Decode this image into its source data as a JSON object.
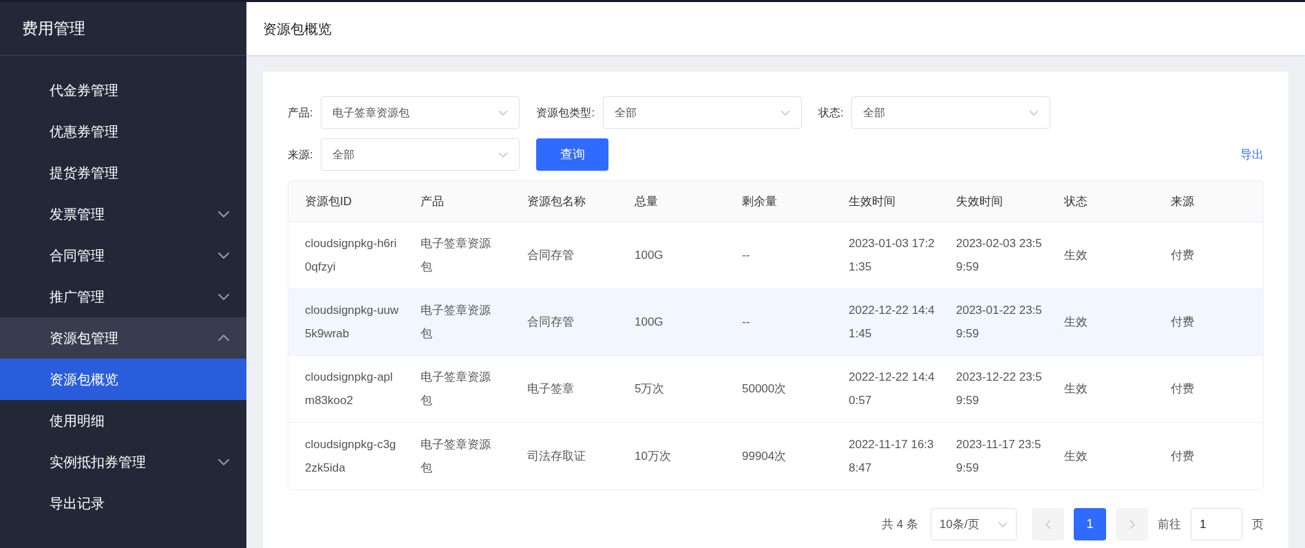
{
  "sidebar": {
    "title": "费用管理",
    "items": [
      {
        "label": "代金券管理",
        "expandable": false,
        "expanded": false,
        "selected": false
      },
      {
        "label": "优惠券管理",
        "expandable": false,
        "expanded": false,
        "selected": false
      },
      {
        "label": "提货券管理",
        "expandable": false,
        "expanded": false,
        "selected": false
      },
      {
        "label": "发票管理",
        "expandable": true,
        "expanded": false,
        "selected": false
      },
      {
        "label": "合同管理",
        "expandable": true,
        "expanded": false,
        "selected": false
      },
      {
        "label": "推广管理",
        "expandable": true,
        "expanded": false,
        "selected": false
      },
      {
        "label": "资源包管理",
        "expandable": true,
        "expanded": true,
        "selected": false,
        "children": [
          {
            "label": "资源包概览",
            "selected": true
          },
          {
            "label": "使用明细",
            "selected": false
          }
        ]
      },
      {
        "label": "实例抵扣券管理",
        "expandable": true,
        "expanded": false,
        "selected": false
      },
      {
        "label": "导出记录",
        "expandable": false,
        "expanded": false,
        "selected": false
      }
    ]
  },
  "header": {
    "title": "资源包概览"
  },
  "filters": [
    {
      "label": "产品:",
      "value": "电子签章资源包"
    },
    {
      "label": "资源包类型:",
      "value": "全部"
    },
    {
      "label": "状态:",
      "value": "全部"
    },
    {
      "label": "来源:",
      "value": "全部"
    }
  ],
  "query_button": "查询",
  "export_link": "导出",
  "table": {
    "columns": [
      "资源包ID",
      "产品",
      "资源包名称",
      "总量",
      "剩余量",
      "生效时间",
      "失效时间",
      "状态",
      "来源"
    ],
    "rows": [
      {
        "selected": false,
        "cells": [
          "cloudsignpkg-h6ri0qfzyi",
          "电子签章资源包",
          "合同存管",
          "100G",
          "--",
          "2023-01-03 17:21:35",
          "2023-02-03 23:59:59",
          "生效",
          "付费"
        ]
      },
      {
        "selected": true,
        "cells": [
          "cloudsignpkg-uuw5k9wrab",
          "电子签章资源包",
          "合同存管",
          "100G",
          "--",
          "2022-12-22 14:41:45",
          "2023-01-22 23:59:59",
          "生效",
          "付费"
        ]
      },
      {
        "selected": false,
        "cells": [
          "cloudsignpkg-aplm83koo2",
          "电子签章资源包",
          "电子签章",
          "5万次",
          "50000次",
          "2022-12-22 14:40:57",
          "2023-12-22 23:59:59",
          "生效",
          "付费"
        ]
      },
      {
        "selected": false,
        "cells": [
          "cloudsignpkg-c3g2zk5ida",
          "电子签章资源包",
          "司法存取证",
          "10万次",
          "99904次",
          "2022-11-17 16:38:47",
          "2023-11-17 23:59:59",
          "生效",
          "付费"
        ]
      }
    ]
  },
  "pagination": {
    "total": "共 4 条",
    "page_size": "10条/页",
    "pages": [
      {
        "label": "1",
        "selected": true
      }
    ],
    "prev_disabled": true,
    "next_disabled": true,
    "goto_label": "前往",
    "goto_value": "1",
    "goto_suffix": "页"
  }
}
